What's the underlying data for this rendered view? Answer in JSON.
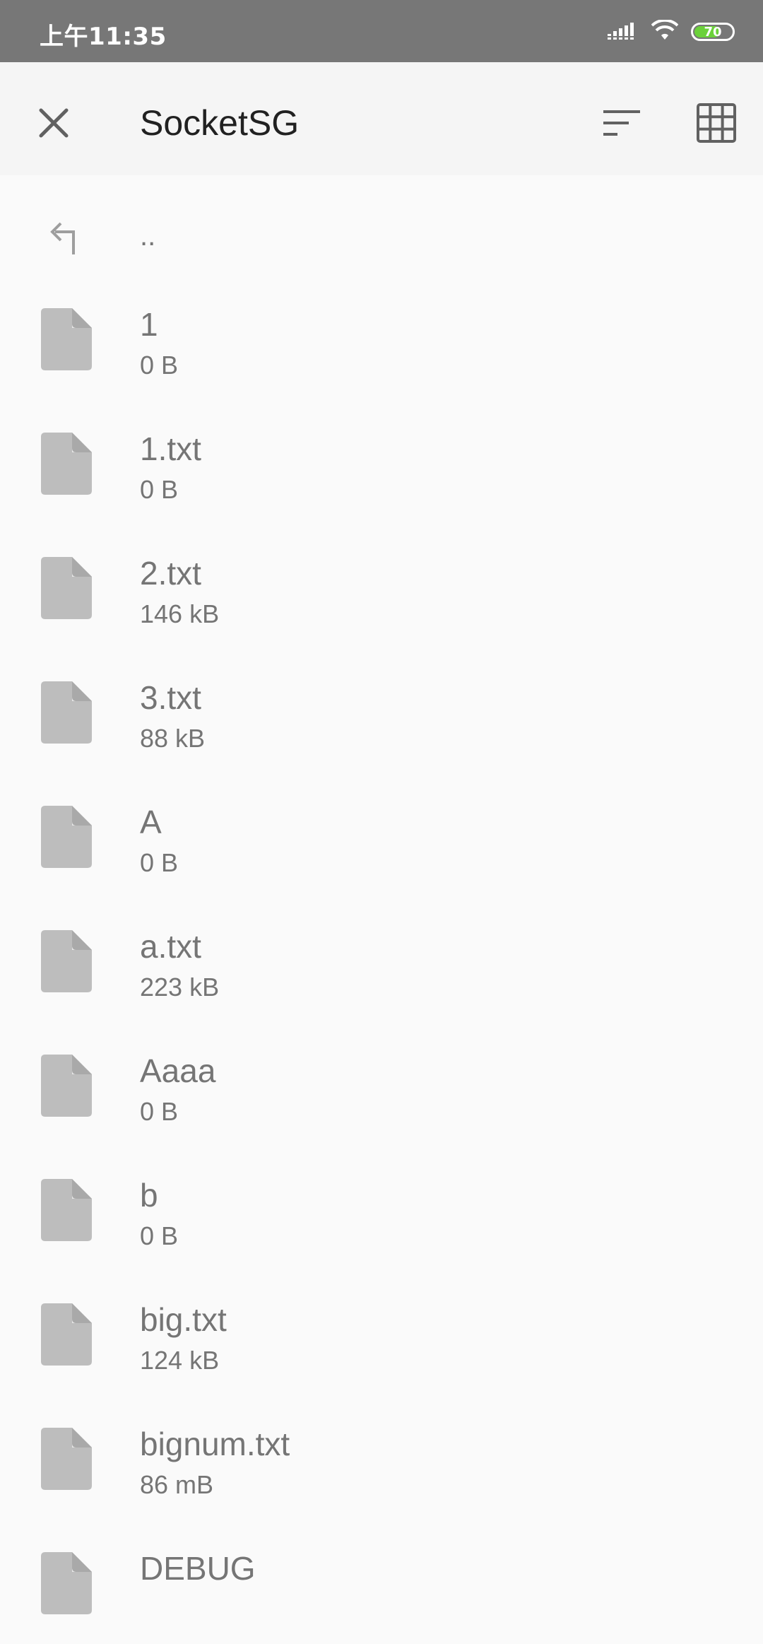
{
  "status_bar": {
    "time": "上午11:35",
    "battery_level": "70",
    "signal_icon": "signal-icon",
    "wifi_icon": "wifi-icon",
    "battery_color": "#6bd13a"
  },
  "app_bar": {
    "title": "SocketSG",
    "close_icon": "close-icon",
    "sort_icon": "sort-icon",
    "grid_icon": "grid-view-icon"
  },
  "parent_dir": {
    "label": "..",
    "icon": "back-arrow-icon"
  },
  "files": [
    {
      "name": "1",
      "size": "0 B"
    },
    {
      "name": "1.txt",
      "size": "0 B"
    },
    {
      "name": "2.txt",
      "size": "146 kB"
    },
    {
      "name": "3.txt",
      "size": "88 kB"
    },
    {
      "name": "A",
      "size": "0 B"
    },
    {
      "name": "a.txt",
      "size": "223 kB"
    },
    {
      "name": "Aaaa",
      "size": "0 B"
    },
    {
      "name": "b",
      "size": "0 B"
    },
    {
      "name": "big.txt",
      "size": "124 kB"
    },
    {
      "name": "bignum.txt",
      "size": "86 mB"
    },
    {
      "name": "DEBUG",
      "size": ""
    }
  ],
  "colors": {
    "status_bar": "#777777",
    "app_bar": "#f5f5f5",
    "background": "#fafafa",
    "icon_gray": "#bdbdbd",
    "text_gray": "#757575"
  }
}
